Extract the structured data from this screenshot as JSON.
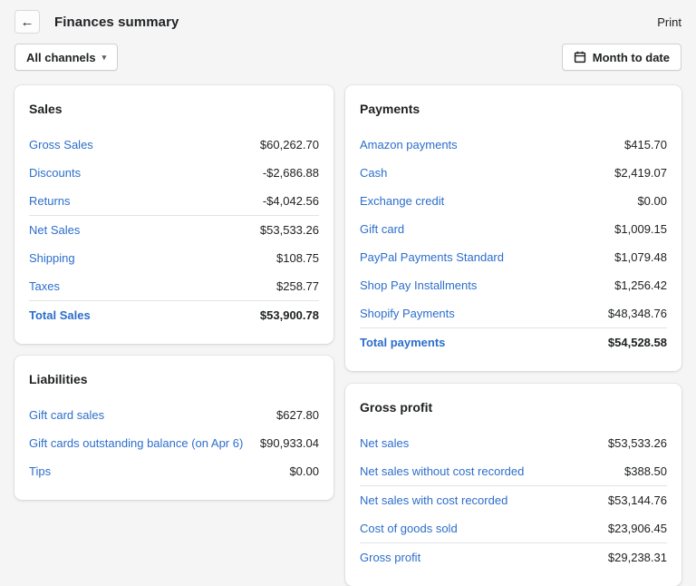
{
  "header": {
    "title": "Finances summary",
    "print_label": "Print"
  },
  "icons": {
    "back_arrow": "←",
    "caret_down": "▾"
  },
  "toolbar": {
    "channel_filter": "All channels",
    "date_range": "Month to date"
  },
  "colors": {
    "link": "#2c6ecb",
    "text": "#202223",
    "background": "#f5f5f6",
    "card": "#ffffff",
    "divider": "#e1e3e5"
  },
  "cards": {
    "sales": {
      "title": "Sales",
      "rows": [
        {
          "label": "Gross Sales",
          "value": "$60,262.70"
        },
        {
          "label": "Discounts",
          "value": "-$2,686.88"
        },
        {
          "label": "Returns",
          "value": "-$4,042.56"
        },
        {
          "label": "Net Sales",
          "value": "$53,533.26"
        },
        {
          "label": "Shipping",
          "value": "$108.75"
        },
        {
          "label": "Taxes",
          "value": "$258.77"
        },
        {
          "label": "Total Sales",
          "value": "$53,900.78"
        }
      ]
    },
    "liabilities": {
      "title": "Liabilities",
      "rows": [
        {
          "label": "Gift card sales",
          "value": "$627.80"
        },
        {
          "label": "Gift cards outstanding balance (on Apr 6)",
          "value": "$90,933.04"
        },
        {
          "label": "Tips",
          "value": "$0.00"
        }
      ]
    },
    "payments": {
      "title": "Payments",
      "rows": [
        {
          "label": "Amazon payments",
          "value": "$415.70"
        },
        {
          "label": "Cash",
          "value": "$2,419.07"
        },
        {
          "label": "Exchange credit",
          "value": "$0.00"
        },
        {
          "label": "Gift card",
          "value": "$1,009.15"
        },
        {
          "label": "PayPal Payments Standard",
          "value": "$1,079.48"
        },
        {
          "label": "Shop Pay Installments",
          "value": "$1,256.42"
        },
        {
          "label": "Shopify Payments",
          "value": "$48,348.76"
        },
        {
          "label": "Total payments",
          "value": "$54,528.58"
        }
      ]
    },
    "gross_profit": {
      "title": "Gross profit",
      "rows": [
        {
          "label": "Net sales",
          "value": "$53,533.26"
        },
        {
          "label": "Net sales without cost recorded",
          "value": "$388.50"
        },
        {
          "label": "Net sales with cost recorded",
          "value": "$53,144.76"
        },
        {
          "label": "Cost of goods sold",
          "value": "$23,906.45"
        },
        {
          "label": "Gross profit",
          "value": "$29,238.31"
        }
      ]
    }
  }
}
